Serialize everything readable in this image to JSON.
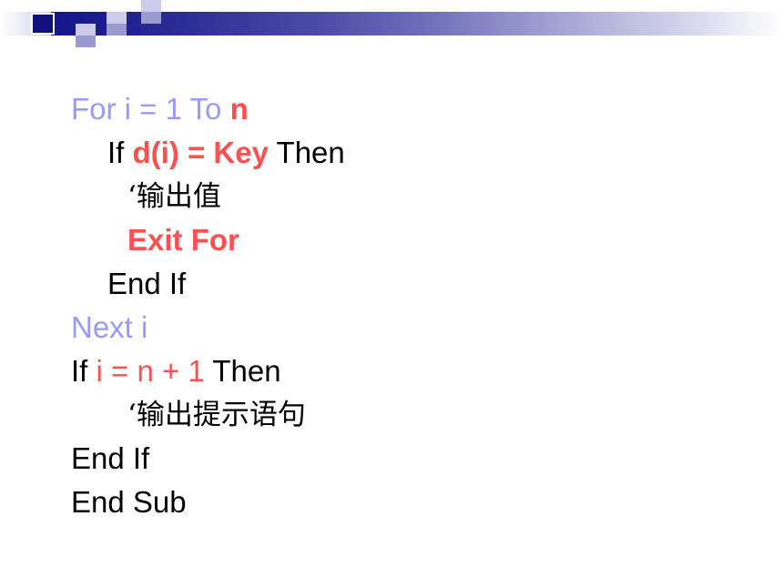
{
  "slide": {
    "background_color": "#ffffff",
    "header": {
      "name": "decorative-header-banner",
      "bar_gradient_from": "#14148c",
      "bar_gradient_to": "#ffffff",
      "square_light": "#ccccea",
      "square_mid": "#9a9ad0",
      "square_dark": "#10107f"
    },
    "palette": {
      "keyword_purple": "#9999ff",
      "highlight_red": "#ff5050",
      "body_black": "#000000"
    },
    "code": {
      "language": "Visual Basic",
      "lines": [
        {
          "id": "line-for",
          "indent": 0,
          "script": "latin",
          "plain_text": "For i = 1 To n",
          "tokens": [
            {
              "text": "For i = 1 To ",
              "style": "keyword"
            },
            {
              "text": "n",
              "style": "red-bold"
            }
          ]
        },
        {
          "id": "line-if-key",
          "indent": 1,
          "script": "latin",
          "plain_text": "If d(i) = Key Then",
          "tokens": [
            {
              "text": "If ",
              "style": "black"
            },
            {
              "text": "d(i) = Key",
              "style": "red-bold"
            },
            {
              "text": " Then",
              "style": "black"
            }
          ]
        },
        {
          "id": "line-comment-output-value",
          "indent": 2,
          "script": "cjk",
          "plain_text": "‘输出值",
          "tokens": [
            {
              "text": "‘输出值",
              "style": "black"
            }
          ]
        },
        {
          "id": "line-exit-for",
          "indent": 2,
          "script": "latin",
          "plain_text": "Exit For",
          "tokens": [
            {
              "text": "Exit For",
              "style": "red-bold"
            }
          ]
        },
        {
          "id": "line-end-if-inner",
          "indent": 1,
          "script": "latin",
          "plain_text": "End If",
          "tokens": [
            {
              "text": "End If",
              "style": "black"
            }
          ]
        },
        {
          "id": "line-next-i",
          "indent": 0,
          "script": "latin",
          "plain_text": "Next i",
          "tokens": [
            {
              "text": "Next i",
              "style": "keyword"
            }
          ]
        },
        {
          "id": "line-if-i-eq-n-plus-1",
          "indent": 0,
          "script": "latin",
          "plain_text": "If i = n + 1 Then",
          "tokens": [
            {
              "text": "If ",
              "style": "black"
            },
            {
              "text": "i = n + 1",
              "style": "red"
            },
            {
              "text": " Then",
              "style": "black"
            }
          ]
        },
        {
          "id": "line-comment-output-prompt",
          "indent": 2,
          "script": "cjk",
          "plain_text": "‘输出提示语句",
          "tokens": [
            {
              "text": "‘输出提示语句",
              "style": "black"
            }
          ]
        },
        {
          "id": "line-end-if-outer",
          "indent": 0,
          "script": "latin",
          "plain_text": "End If",
          "tokens": [
            {
              "text": "End If",
              "style": "black"
            }
          ]
        },
        {
          "id": "line-end-sub",
          "indent": 0,
          "script": "latin",
          "plain_text": "End Sub",
          "tokens": [
            {
              "text": "End Sub",
              "style": "black"
            }
          ]
        }
      ]
    }
  }
}
